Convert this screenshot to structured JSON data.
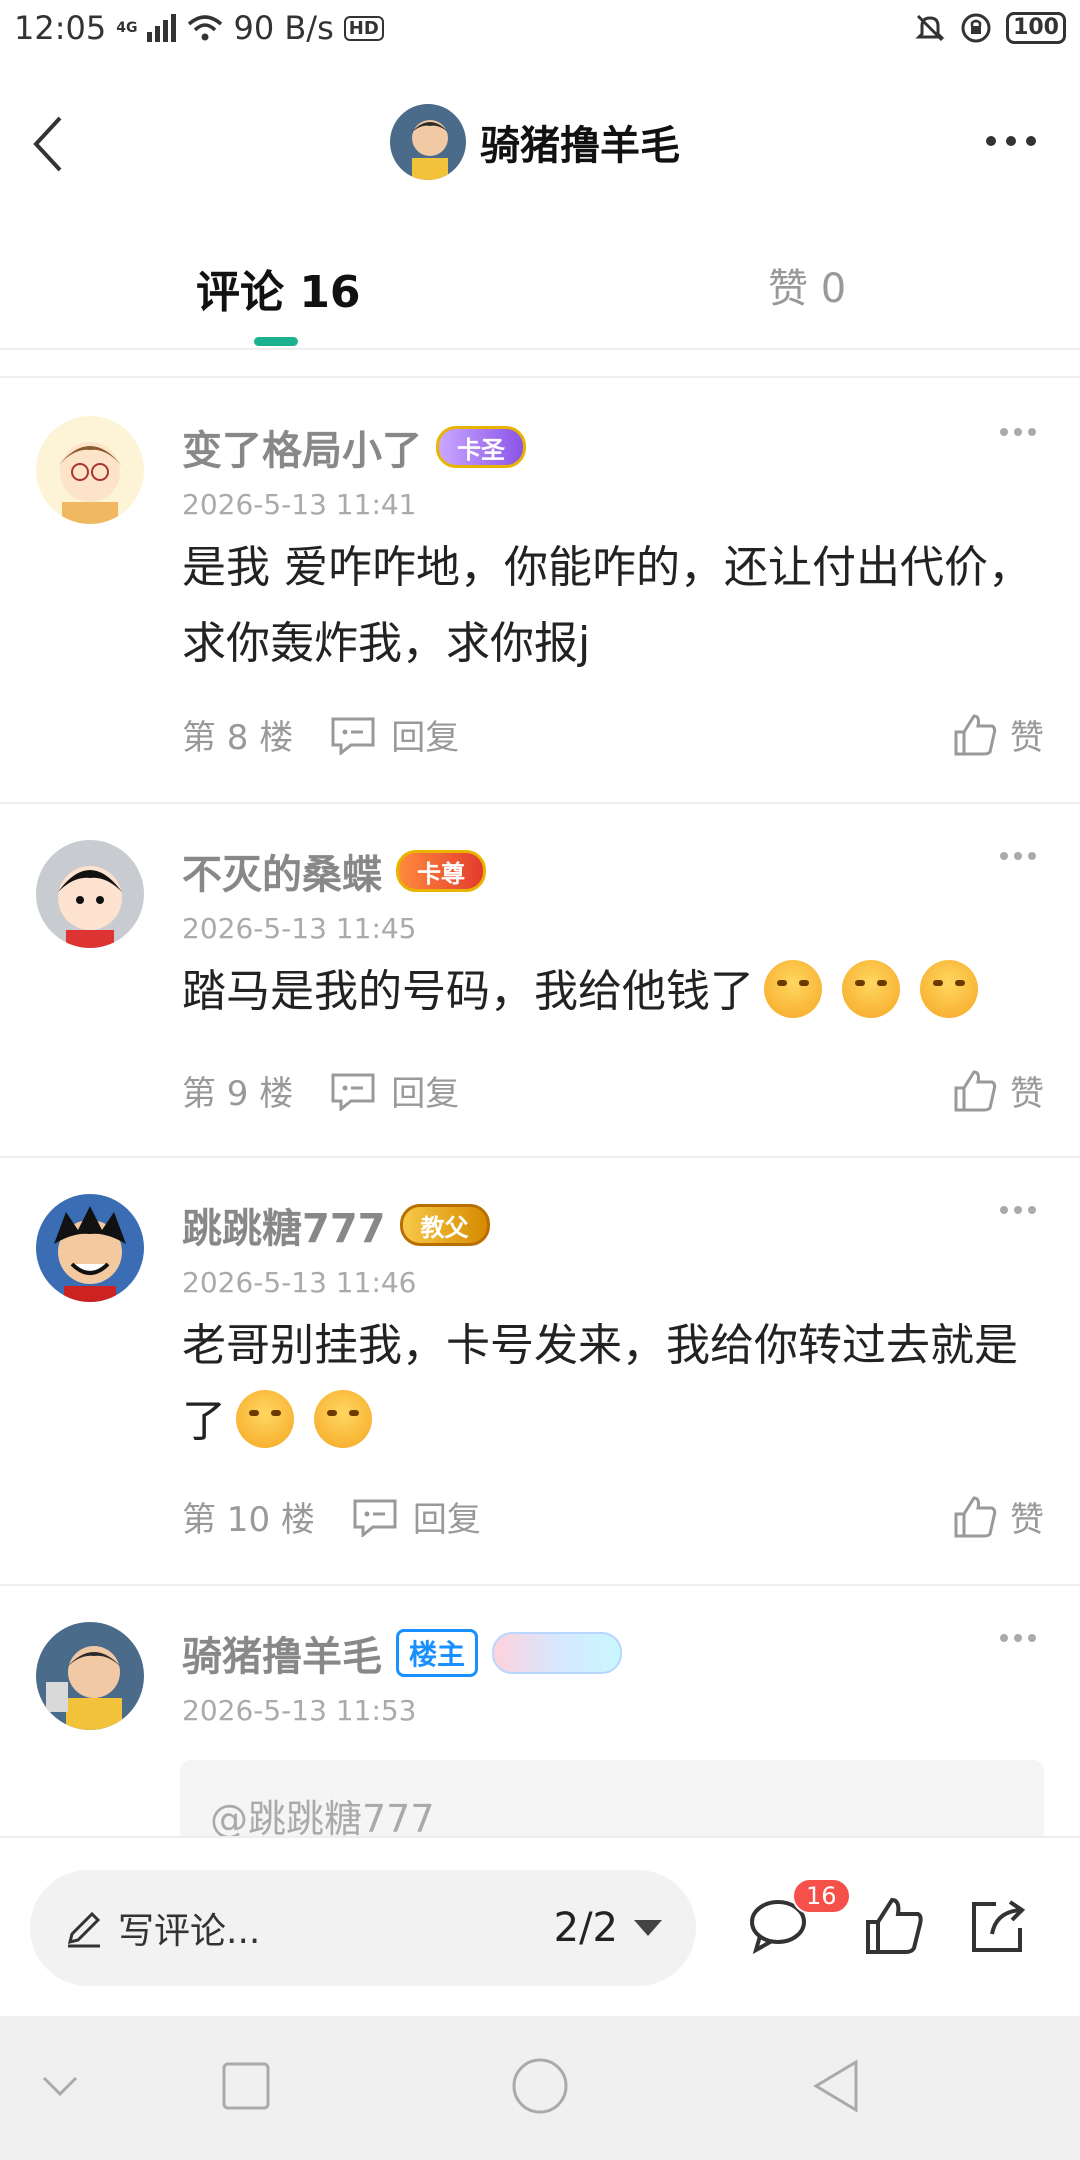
{
  "status_bar": {
    "time": "12:05",
    "network": "4G",
    "speed": "90 B/s",
    "hd": "HD",
    "battery": "100"
  },
  "header": {
    "title": "骑猪撸羊毛"
  },
  "tabs": {
    "comments_label": "评论 16",
    "likes_label": "赞 0"
  },
  "comments": [
    {
      "username": "变了格局小了",
      "badge": "卡圣",
      "time": "2026-5-13 11:41",
      "content": "是我 爱咋咋地，你能咋的，还让付出代价，求你轰炸我，求你报j",
      "floor": "第 8 楼",
      "reply_label": "回复",
      "like_label": "赞"
    },
    {
      "username": "不灭的桑蝶",
      "badge": "卡尊",
      "time": "2026-5-13 11:45",
      "content": "踏马是我的号码，我给他钱了",
      "floor": "第 9 楼",
      "reply_label": "回复",
      "like_label": "赞"
    },
    {
      "username": "跳跳糖777",
      "badge": "教父",
      "time": "2026-5-13 11:46",
      "content": "老哥别挂我，卡号发来，我给你转过去就是了",
      "floor": "第 10 楼",
      "reply_label": "回复",
      "like_label": "赞"
    },
    {
      "username": "骑猪撸羊毛",
      "badge": "楼主",
      "time": "2026-5-13 11:53",
      "quote": "@跳跳糖777"
    }
  ],
  "bottom_bar": {
    "compose_placeholder": "写评论...",
    "page_indicator": "2/2",
    "comment_count": "16"
  },
  "colors": {
    "accent": "#1db28f",
    "badge_red": "#f5504a",
    "owner_blue": "#1890ff"
  }
}
